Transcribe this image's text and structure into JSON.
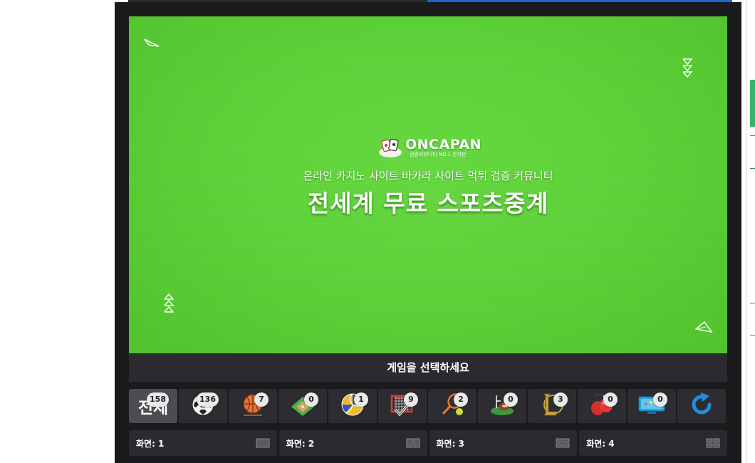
{
  "stream": {
    "logo_text": "ONCAPAN",
    "logo_sub": "검증커뮤니티 NO.1 온카판",
    "tagline": "온라인 카지노 사이트 바카라 사이트 먹튀 검증 커뮤니티",
    "headline": "전세계 무료 스포츠중계"
  },
  "select_prompt": "게임을 선택하세요",
  "games": [
    {
      "label": "전체",
      "icon": "all-label",
      "count": "158"
    },
    {
      "icon": "soccer-icon",
      "count": "136"
    },
    {
      "icon": "basketball-icon",
      "count": "7"
    },
    {
      "icon": "baseball-icon",
      "count": "0"
    },
    {
      "icon": "volleyball-icon",
      "count": "1"
    },
    {
      "icon": "hockey-net-icon",
      "count": "9"
    },
    {
      "icon": "tennis-icon",
      "count": "2"
    },
    {
      "icon": "american-football-icon",
      "count": "0"
    },
    {
      "icon": "league-of-legends-icon",
      "count": "3"
    },
    {
      "icon": "boxing-icon",
      "count": "0"
    },
    {
      "icon": "esports-icon",
      "count": "0"
    },
    {
      "icon": "refresh-icon"
    }
  ],
  "screens": [
    {
      "label": "화면: 1",
      "icon": "layout-1-icon"
    },
    {
      "label": "화면: 2",
      "icon": "layout-2-icon"
    },
    {
      "label": "화면: 3",
      "icon": "layout-3-icon"
    },
    {
      "label": "화면: 4",
      "icon": "layout-4-icon"
    }
  ],
  "colors": {
    "panel": "#1b1b1d",
    "video_green": "#5fd33a",
    "button": "#2d2d31",
    "refresh": "#1e8fe0"
  }
}
